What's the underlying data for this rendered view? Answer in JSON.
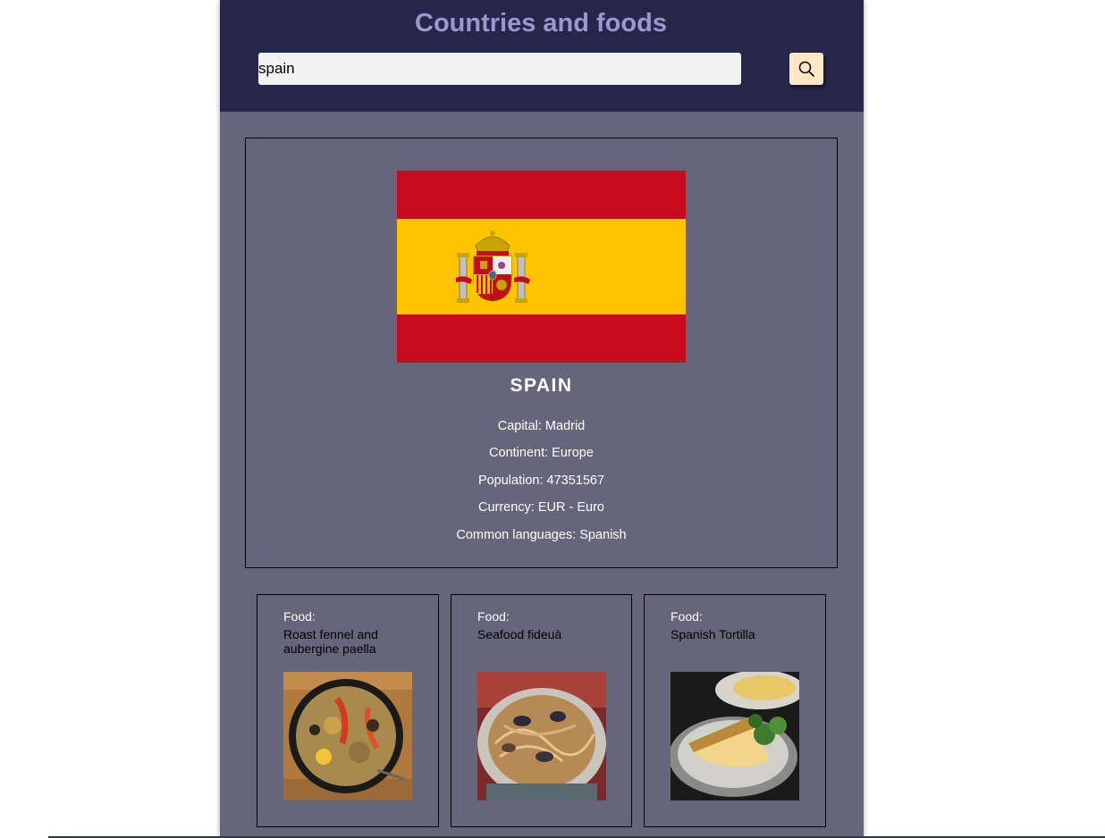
{
  "header": {
    "title": "Countries and foods",
    "search_value": "spain"
  },
  "country": {
    "name": "SPAIN",
    "capital": "Capital: Madrid",
    "continent": "Continent: Europe",
    "population": "Population: 47351567",
    "currency": "Currency: EUR - Euro",
    "languages": "Common languages: Spanish",
    "flag_colors": {
      "red": "#c60b1e",
      "yellow": "#ffc400"
    }
  },
  "foods": [
    {
      "label": "Food:",
      "name": "Roast fennel and aubergine paella"
    },
    {
      "label": "Food:",
      "name": "Seafood fideuà"
    },
    {
      "label": "Food:",
      "name": "Spanish Tortilla"
    }
  ],
  "colors": {
    "header_bg": "#26254a",
    "panel_bg": "#67657c",
    "title": "#9b97cf",
    "search_button": "#ffe7c6"
  }
}
